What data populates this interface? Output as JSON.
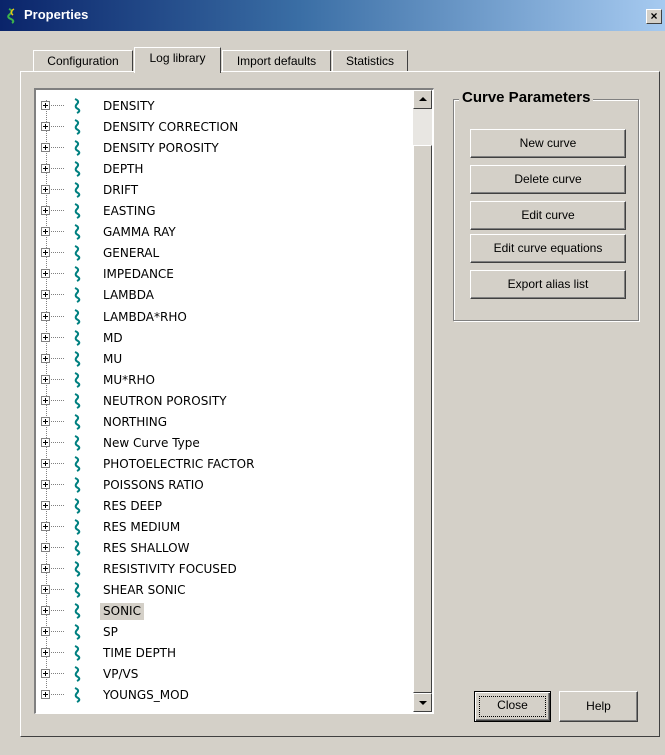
{
  "window": {
    "title": "Properties",
    "close_glyph": "×"
  },
  "tabs": [
    {
      "label": "Configuration"
    },
    {
      "label": "Log library",
      "active": true
    },
    {
      "label": "Import defaults"
    },
    {
      "label": "Statistics"
    }
  ],
  "tree": {
    "items": [
      "DENSITY",
      "DENSITY CORRECTION",
      "DENSITY POROSITY",
      "DEPTH",
      "DRIFT",
      "EASTING",
      "GAMMA RAY",
      "GENERAL",
      "IMPEDANCE",
      "LAMBDA",
      "LAMBDA*RHO",
      "MD",
      "MU",
      "MU*RHO",
      "NEUTRON POROSITY",
      "NORTHING",
      "New Curve Type",
      "PHOTOELECTRIC FACTOR",
      "POISSONS RATIO",
      "RES DEEP",
      "RES MEDIUM",
      "RES SHALLOW",
      "RESISTIVITY FOCUSED",
      "SHEAR SONIC",
      "SONIC",
      "SP",
      "TIME DEPTH",
      "VP/VS",
      "YOUNGS_MOD"
    ],
    "selected": "SONIC",
    "item_icon": "curve-type-icon",
    "icon_color": "#008080"
  },
  "curve_parameters": {
    "title": "Curve Parameters",
    "buttons": {
      "new": "New curve",
      "delete": "Delete curve",
      "edit": "Edit curve",
      "edit_equations": "Edit curve equations",
      "export_alias": "Export alias list"
    }
  },
  "footer": {
    "close": "Close",
    "help": "Help"
  },
  "colors": {
    "face": "#d4d0c8",
    "title_gradient_start": "#0a246a",
    "title_gradient_end": "#a6caf0",
    "selection": "#d4d0c8"
  }
}
